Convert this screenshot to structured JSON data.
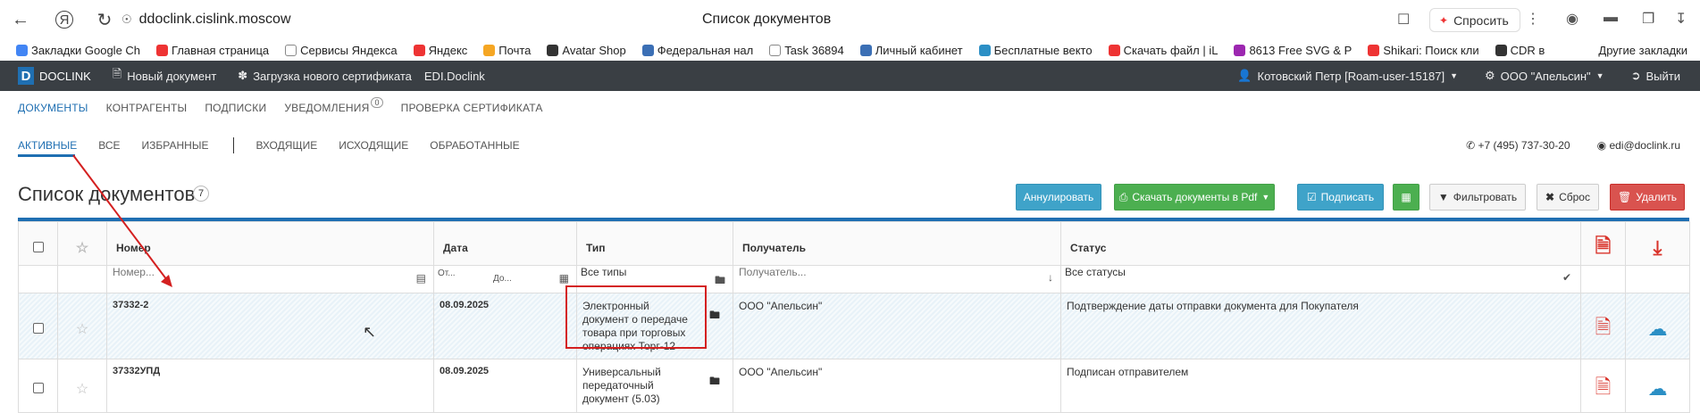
{
  "browser": {
    "url": "ddoclink.cislink.moscow",
    "page_title": "Список документов",
    "ask_label": "Спросить"
  },
  "bookmarks": [
    {
      "label": "Закладки Google Ch",
      "color": "#4285f4"
    },
    {
      "label": "Главная страница",
      "color": "#e33"
    },
    {
      "label": "Сервисы Яндекса",
      "color": "#fff"
    },
    {
      "label": "Яндекс",
      "color": "#e33"
    },
    {
      "label": "Почта",
      "color": "#f5a623"
    },
    {
      "label": "Avatar Shop",
      "color": "#333"
    },
    {
      "label": "Федеральная нал",
      "color": "#3b6fb5"
    },
    {
      "label": "Task 36894",
      "color": "#fff"
    },
    {
      "label": "Личный кабинет",
      "color": "#3b6fb5"
    },
    {
      "label": "Бесплатные векто",
      "color": "#2b8fc5"
    },
    {
      "label": "Скачать файл | iL",
      "color": "#e33"
    },
    {
      "label": "8613 Free SVG & P",
      "color": "#9c27b0"
    },
    {
      "label": "Shikari: Поиск кли",
      "color": "#e33"
    },
    {
      "label": "CDR в",
      "color": "#333"
    }
  ],
  "bookmarks_other": "Другие закладки",
  "appbar": {
    "logo_letter": "D",
    "logo_text": "DOCLINK",
    "new_doc": "Новый документ",
    "upload_cert": "Загрузка нового сертификата",
    "edi": "EDI.Doclink",
    "user": "Котовский Петр [Roam-user-15187]",
    "org": "ООО \"Апельсин\"",
    "logout": "Выйти"
  },
  "menu_main": {
    "documents": "ДОКУМЕНТЫ",
    "contractors": "КОНТРАГЕНТЫ",
    "signatures": "ПОДПИСКИ",
    "notifications": "УВЕДОМЛЕНИЯ",
    "notifications_count": "0",
    "cert_check": "ПРОВЕРКА СЕРТИФИКАТА"
  },
  "menu_sub": {
    "active": "АКТИВНЫЕ",
    "all": "ВСЕ",
    "favorites": "ИЗБРАННЫЕ",
    "incoming": "ВХОДЯЩИЕ",
    "outgoing": "ИСХОДЯЩИЕ",
    "processed": "ОБРАБОТАННЫЕ"
  },
  "contacts": {
    "phone": "+7 (495) 737-30-20",
    "email": "edi@doclink.ru"
  },
  "list": {
    "title": "Список документов",
    "count": "7"
  },
  "actions": {
    "annul": "Аннулировать",
    "download_pdf": "Скачать документы в Pdf",
    "sign": "Подписать",
    "filter": "Фильтровать",
    "reset": "Сброс",
    "delete": "Удалить"
  },
  "columns": {
    "number": "Номер",
    "date": "Дата",
    "type": "Тип",
    "recipient": "Получатель",
    "status": "Статус"
  },
  "filters": {
    "number_placeholder": "Номер...",
    "date_from": "От...",
    "date_to": "До...",
    "type": "Все типы",
    "recipient_placeholder": "Получатель...",
    "status": "Все статусы"
  },
  "rows": [
    {
      "number": "37332-2",
      "date": "08.09.2025",
      "type": "Электронный документ о передаче товара при торговых операциях Торг-12",
      "recipient": "ООО \"Апельсин\"",
      "status": "Подтверждение даты отправки документа для Покупателя"
    },
    {
      "number": "37332УПД",
      "date": "08.09.2025",
      "type": "Универсальный передаточный документ (5.03)",
      "recipient": "ООО \"Апельсин\"",
      "status": "Подписан отправителем"
    }
  ],
  "colors": {
    "accent": "#1f6fb2",
    "annotation": "#d42020"
  }
}
